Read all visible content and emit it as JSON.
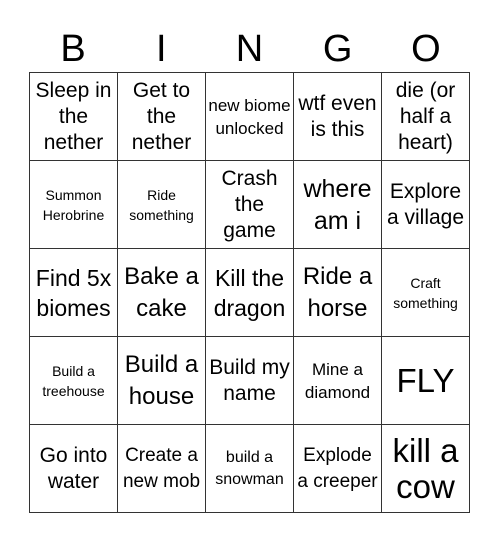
{
  "header": {
    "letters": [
      "B",
      "I",
      "N",
      "G",
      "O"
    ]
  },
  "cells": [
    [
      "Sleep in the nether",
      "Get to the nether",
      "new biome unlocked",
      "wtf even is this",
      "die (or half a heart)"
    ],
    [
      "Summon Herobrine",
      "Ride something",
      "Crash the game",
      "where am i",
      "Explore a village"
    ],
    [
      "Find 5x biomes",
      "Bake a cake",
      "Kill the dragon",
      "Ride a horse",
      "Craft something"
    ],
    [
      "Build a treehouse",
      "Build a house",
      "Build my name",
      "Mine a diamond",
      "FLY"
    ],
    [
      "Go into water",
      "Create a new mob",
      "build a snowman",
      "Explode a creeper",
      "kill a cow"
    ]
  ],
  "colors": {
    "grid_line": "#333333",
    "text": "#000000",
    "background": "#ffffff"
  }
}
